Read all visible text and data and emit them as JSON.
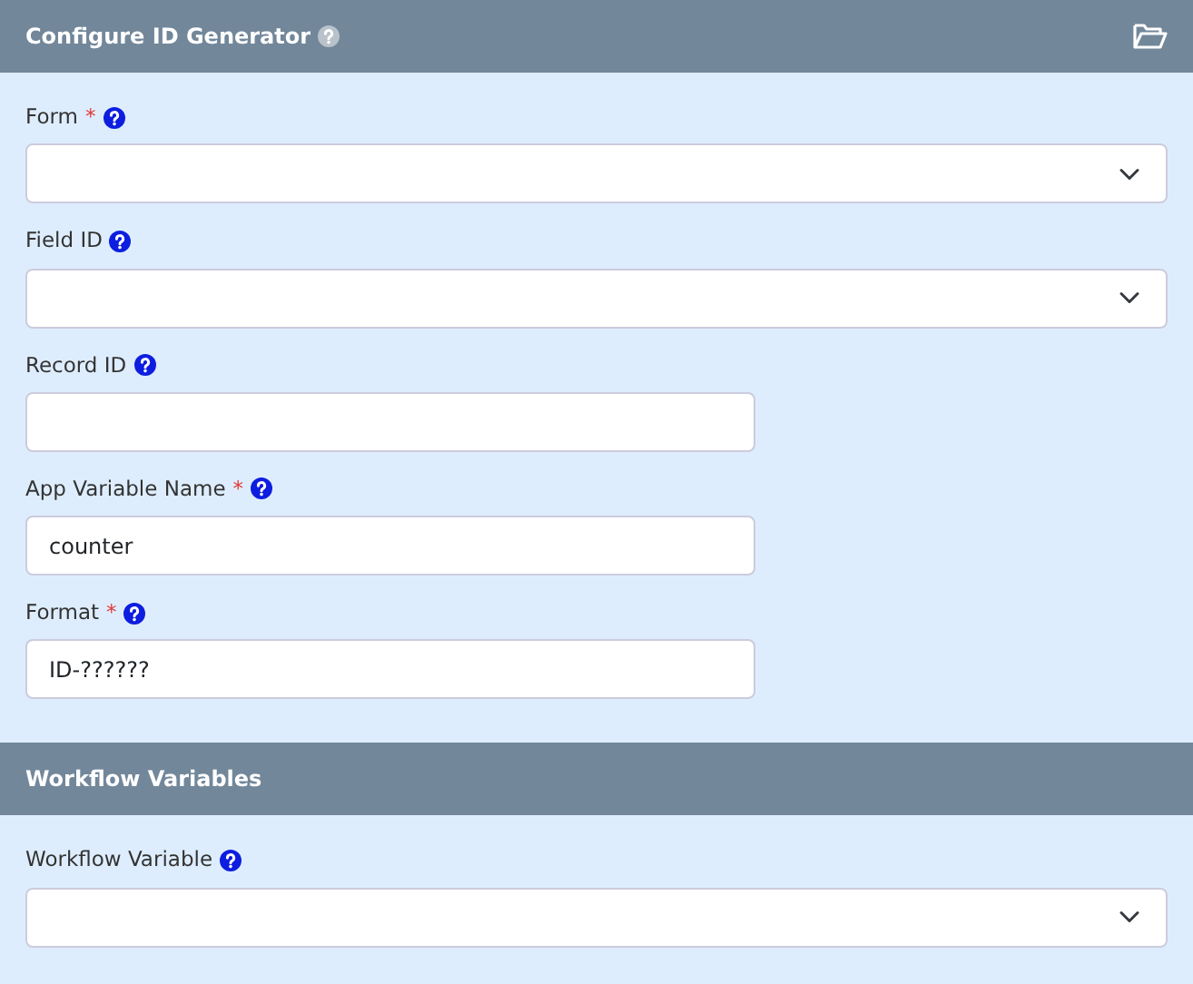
{
  "sections": [
    {
      "title": "Configure ID Generator",
      "help": true,
      "folder": true,
      "fields": [
        {
          "label": "Form",
          "required_mark": "*",
          "kind": "select",
          "wide": true
        },
        {
          "label": "Field ID",
          "kind": "select",
          "wide": true
        },
        {
          "label": "Record ID",
          "kind": "text",
          "wide": false
        },
        {
          "label": "App Variable Name",
          "required_mark": "*",
          "kind": "text",
          "wide": false,
          "value": "counter"
        },
        {
          "label": "Format",
          "required_mark": "*",
          "kind": "text",
          "wide": false,
          "value": "ID-??????"
        }
      ]
    },
    {
      "title": "Workflow Variables",
      "help": false,
      "folder": false,
      "fields": [
        {
          "label": "Workflow Variable",
          "kind": "select",
          "wide": true
        }
      ]
    }
  ]
}
